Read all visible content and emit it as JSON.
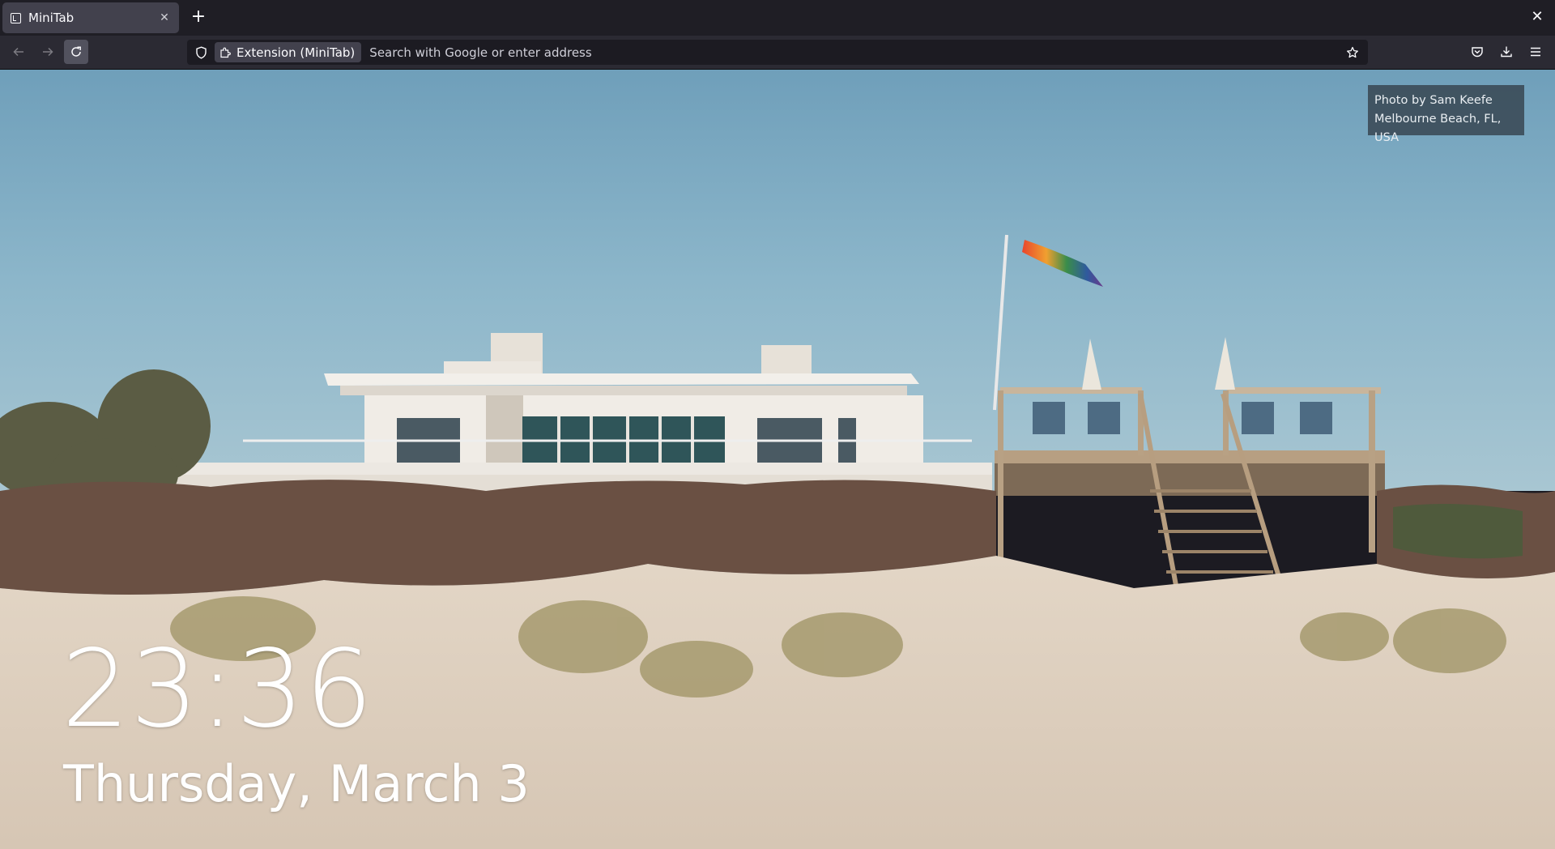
{
  "browser": {
    "tab": {
      "title": "MiniTab",
      "close_symbol": "✕"
    },
    "new_tab_symbol": "+",
    "window_close_symbol": "✕",
    "urlbar": {
      "identity_label": "Extension (MiniTab)",
      "placeholder": "Search with Google or enter address",
      "value": ""
    },
    "icons": {
      "back": "back-arrow-icon",
      "forward": "forward-arrow-icon",
      "reload": "reload-icon",
      "shield": "shield-icon",
      "puzzle": "puzzle-piece-icon",
      "star": "star-bookmark-icon",
      "pocket": "pocket-icon",
      "downloads": "download-icon",
      "menu": "hamburger-menu-icon"
    }
  },
  "newtab": {
    "photo_credit": {
      "line1": "Photo by Sam Keefe",
      "line2": "Melbourne Beach, FL, USA"
    },
    "clock": "23:36",
    "date": "Thursday, March 3"
  },
  "colors": {
    "tabstrip_bg": "#1f1e25",
    "toolbar_bg": "#2b2a33",
    "sky": "#86b1c8",
    "sand": "#ddcfbe"
  }
}
